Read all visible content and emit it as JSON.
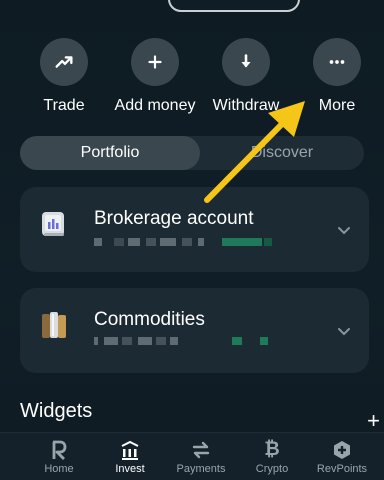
{
  "actions": [
    {
      "label": "Trade",
      "icon": "trend-up-icon"
    },
    {
      "label": "Add money",
      "icon": "plus-icon"
    },
    {
      "label": "Withdraw",
      "icon": "arrow-down-icon"
    },
    {
      "label": "More",
      "icon": "more-dots-icon"
    }
  ],
  "tabs": {
    "portfolio": "Portfolio",
    "discover": "Discover",
    "active": "Portfolio"
  },
  "cards": [
    {
      "title": "Brokerage account",
      "icon": "brokerage-chart-icon"
    },
    {
      "title": "Commodities",
      "icon": "commodities-bars-icon"
    }
  ],
  "widgets": {
    "title": "Widgets",
    "add_label": "+"
  },
  "nav": [
    {
      "label": "Home",
      "icon": "revolut-r-icon"
    },
    {
      "label": "Invest",
      "icon": "invest-chart-icon",
      "active": true
    },
    {
      "label": "Payments",
      "icon": "swap-arrows-icon"
    },
    {
      "label": "Crypto",
      "icon": "bitcoin-icon"
    },
    {
      "label": "RevPoints",
      "icon": "revpoints-hex-icon"
    }
  ],
  "colors": {
    "background": "#0f1d26",
    "card": "#1c2a33",
    "action_circle": "#3a474f",
    "annotation_arrow": "#f5c518"
  }
}
